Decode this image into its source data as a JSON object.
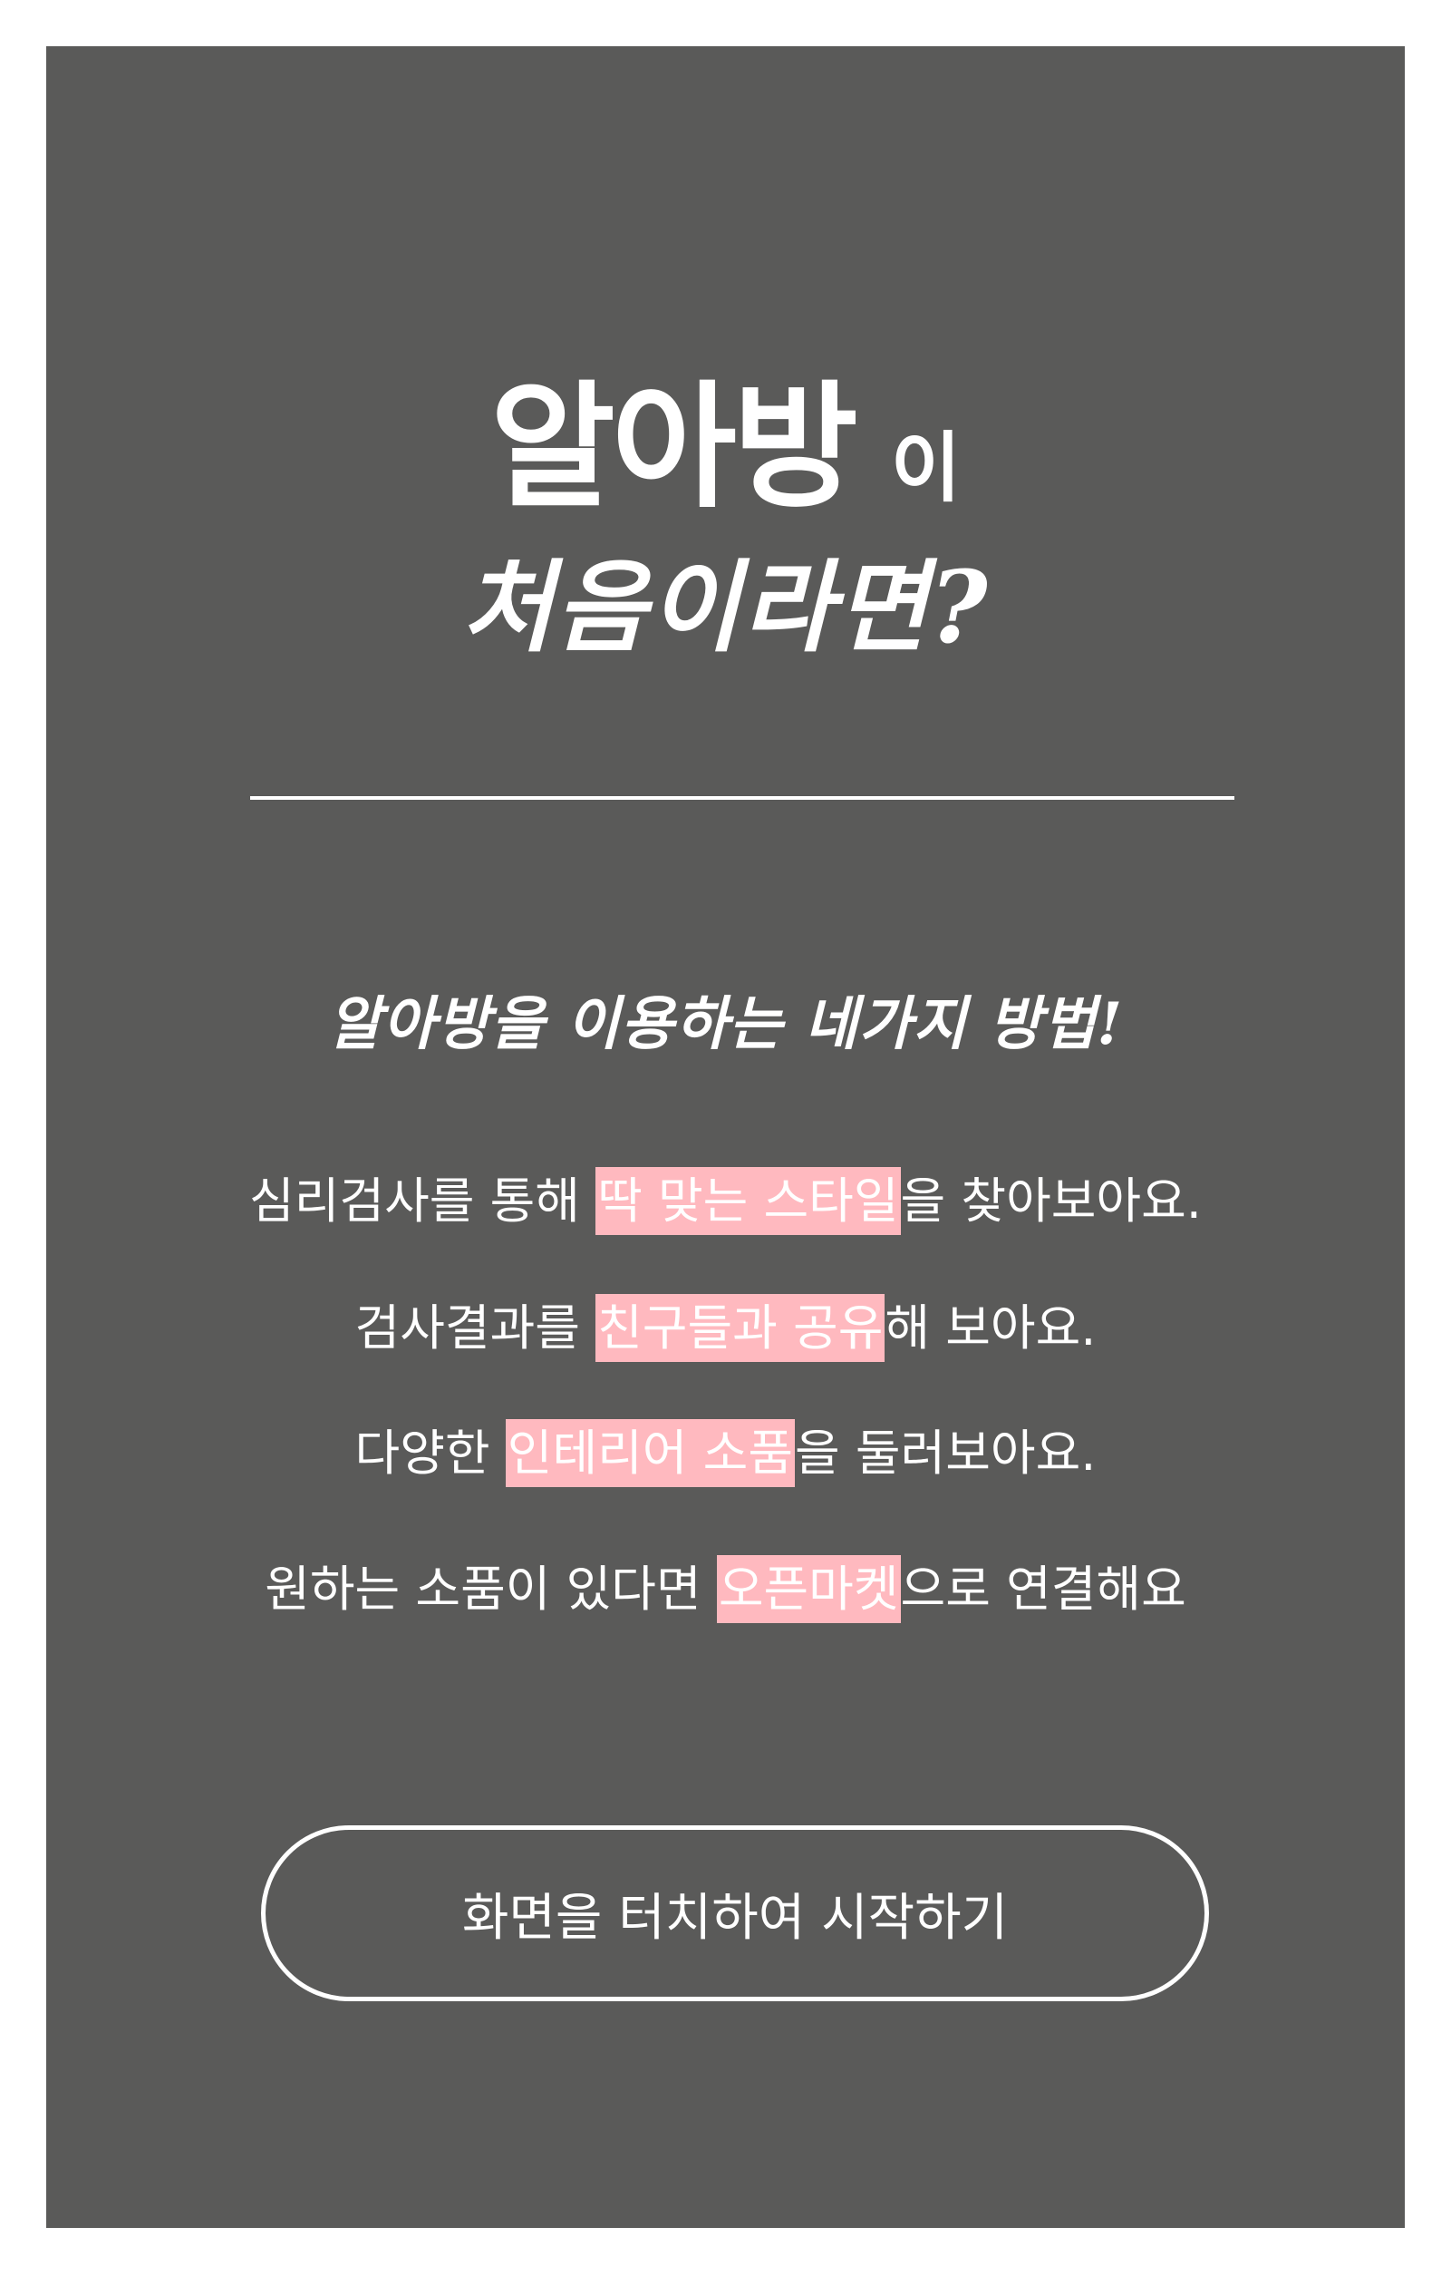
{
  "header": {
    "brand": "알아방",
    "brand_suffix": "이",
    "title_line2": "처음이라면?"
  },
  "section": {
    "subtitle": "알아방을 이용하는 네가지 방법!"
  },
  "lines": [
    {
      "before": "심리검사를 통해 ",
      "highlight": "딱 맞는 스타일",
      "after": "을 찾아보아요."
    },
    {
      "before": "검사결과를 ",
      "highlight": "친구들과 공유",
      "after": "해 보아요."
    },
    {
      "before": "다양한 ",
      "highlight": "인테리어 소품",
      "after": "을 둘러보아요."
    },
    {
      "before": "원하는 소품이 있다면 ",
      "highlight": "오픈마켓",
      "after": "으로 연결해요"
    }
  ],
  "start_button": {
    "label": "화면을 터치하여 시작하기"
  },
  "colors": {
    "panel_background": "#5a5a59",
    "highlight": "#ffb9bf",
    "text": "#ffffff"
  }
}
